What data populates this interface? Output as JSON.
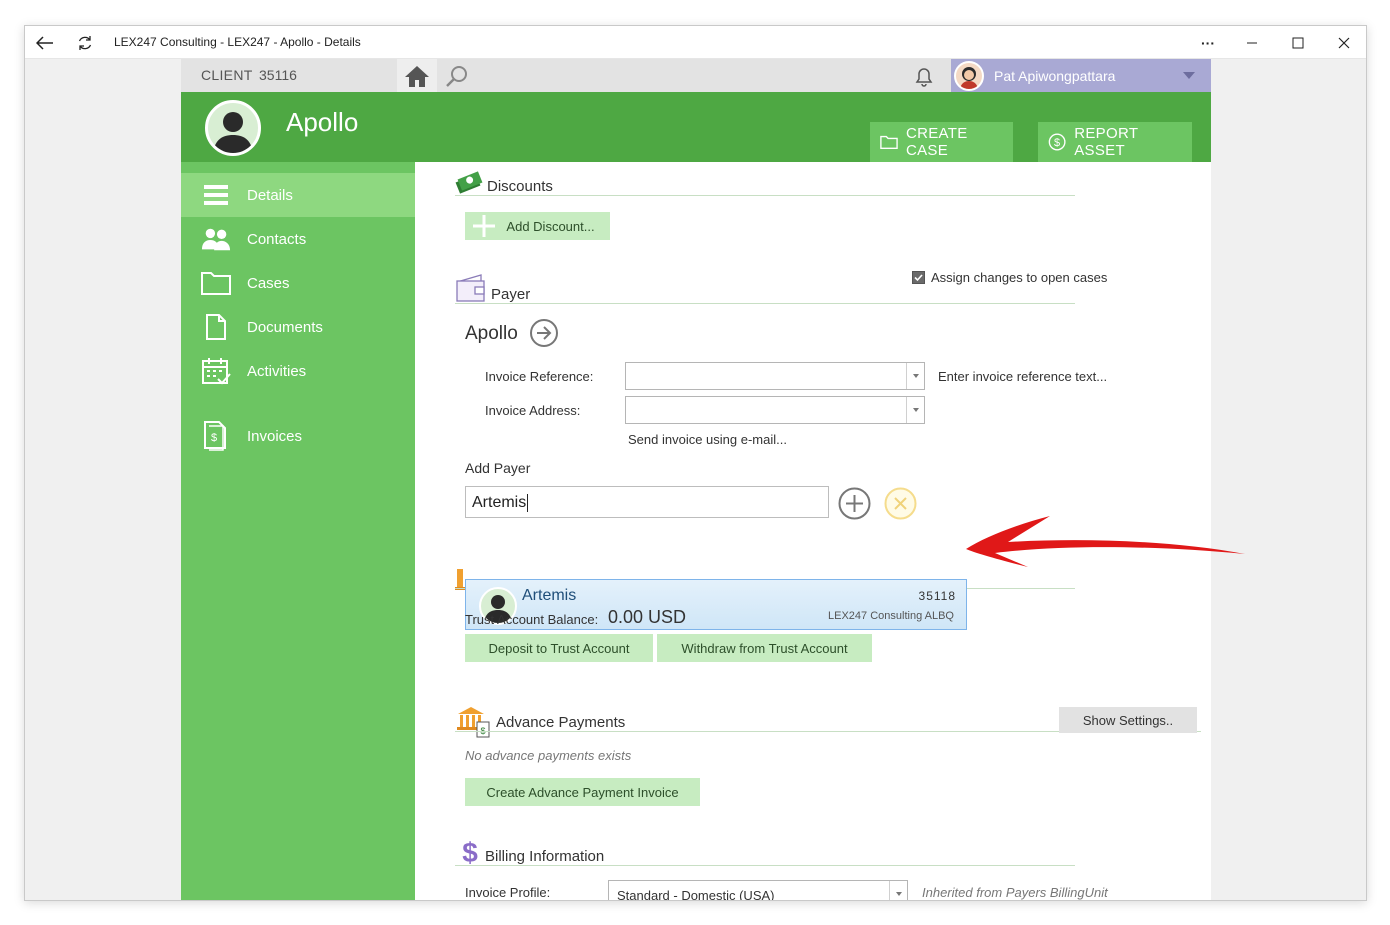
{
  "window": {
    "title": "LEX247 Consulting - LEX247 - Apollo - Details",
    "more_label": "···"
  },
  "topbar": {
    "client_label": "CLIENT",
    "client_id": "35116",
    "user_name": "Pat Apiwongpattara"
  },
  "header": {
    "entity_name": "Apollo",
    "create_case_label": "CREATE CASE",
    "report_asset_label": "REPORT ASSET"
  },
  "sidebar": {
    "items": [
      {
        "label": "Details",
        "icon": "details-icon",
        "active": true
      },
      {
        "label": "Contacts",
        "icon": "contacts-icon"
      },
      {
        "label": "Cases",
        "icon": "folder-icon"
      },
      {
        "label": "Documents",
        "icon": "document-icon"
      },
      {
        "label": "Activities",
        "icon": "calendar-icon"
      },
      {
        "label": "Invoices",
        "icon": "invoice-icon"
      }
    ]
  },
  "discounts": {
    "title": "Discounts",
    "add_label": "Add Discount..."
  },
  "payer": {
    "assign_label": "Assign changes to open cases",
    "assign_checked": true,
    "title": "Payer",
    "payer_name": "Apollo",
    "invoice_reference_label": "Invoice Reference:",
    "invoice_reference_value": "",
    "invoice_reference_hint": "Enter invoice reference text...",
    "invoice_address_label": "Invoice Address:",
    "invoice_address_value": "",
    "send_email_label": "Send invoice using e-mail...",
    "add_payer_label": "Add Payer",
    "add_payer_input": "Artemis"
  },
  "suggestion": {
    "name": "Artemis",
    "id": "35118",
    "org": "LEX247 Consulting ALBQ"
  },
  "trust": {
    "balance_label": "Trust Account Balance:",
    "balance_value": "0.00 USD",
    "deposit_label": "Deposit to Trust Account",
    "withdraw_label": "Withdraw from Trust Account"
  },
  "advance": {
    "title": "Advance Payments",
    "settings_label": "Show Settings..",
    "empty_text": "No advance payments exists",
    "create_label": "Create Advance Payment Invoice"
  },
  "billing": {
    "title": "Billing Information",
    "profile_label": "Invoice Profile:",
    "profile_value": "Standard - Domestic (USA)",
    "inherited_text": "Inherited from Payers BillingUnit"
  },
  "colors": {
    "header_green": "#4ea843",
    "sidebar_green": "#6cc562",
    "active_green": "#8ed880",
    "button_green": "#c7ecc1",
    "user_area": "#a9a9d4",
    "annotation_arrow": "#e01818"
  }
}
